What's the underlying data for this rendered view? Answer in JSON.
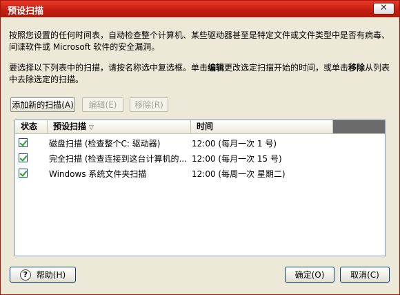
{
  "window": {
    "title": "预设扫描"
  },
  "description": {
    "para1": "按照您设置的任何时间表，自动检查整个计算机、某些驱动器甚至是特定文件或文件类型中是否有病毒、间谍软件或 Microsoft 软件的安全漏洞。",
    "para2_a": "要选择以下列表中的扫描，请按名称选中复选框。单击",
    "para2_edit": "编辑",
    "para2_b": "更改选定扫描开始的时间，或单击",
    "para2_remove": "移除",
    "para2_c": "从列表中去除选定的扫描。"
  },
  "toolbar": {
    "add_label": "添加新的扫描(A)",
    "edit_label": "编辑(E)",
    "remove_label": "移除(R)"
  },
  "table": {
    "columns": {
      "status": "状态",
      "name": "预设扫描",
      "time": "时间"
    },
    "sort_icon": "chevron-down-icon",
    "rows": [
      {
        "name": "磁盘扫描 (检查整个C: 驱动器)",
        "time": "12:00 (每月一次  1 号)",
        "checked": true
      },
      {
        "name": "完全扫描 (检查连接到这台计算机的...",
        "time": "12:00 (每月一次  15 号)",
        "checked": true
      },
      {
        "name": "Windows 系统文件夹扫描",
        "time": "12:00 (每周一次  星期二)",
        "checked": true
      }
    ]
  },
  "buttons": {
    "help_label": "帮助(H)",
    "ok_label": "确定(O)",
    "cancel_label": "取消(C)",
    "help_icon": "?"
  },
  "colors": {
    "titlebar": "#c41f10",
    "accent": "#21a121"
  }
}
